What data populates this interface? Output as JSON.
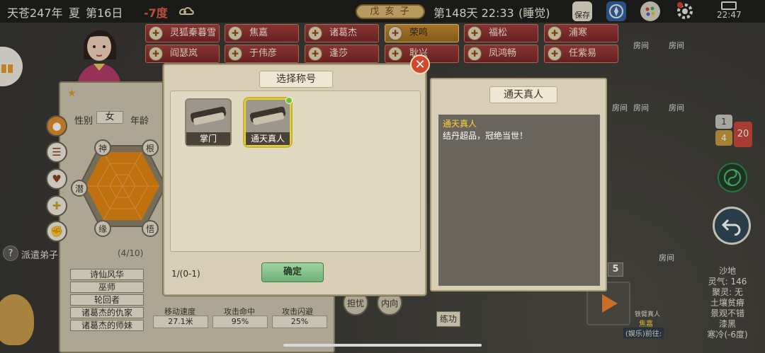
{
  "topbar": {
    "date": "天苍247年",
    "season": "夏",
    "day_label": "第16日",
    "temperature": "-7度",
    "ganzhi": "戊 亥 子",
    "day_count_time": "第148天 22:33",
    "status": "(睡觉)",
    "save_label": "保存",
    "clock": "22:47"
  },
  "disciples": [
    {
      "name": "灵狐秦暮雪",
      "selected": false
    },
    {
      "name": "焦嘉",
      "selected": false
    },
    {
      "name": "诸葛杰",
      "selected": false
    },
    {
      "name": "荣鸣",
      "selected": true
    },
    {
      "name": "福松",
      "selected": false
    },
    {
      "name": "浦寒",
      "selected": false
    },
    {
      "name": "阎瑟岚",
      "selected": false
    },
    {
      "name": "于伟彦",
      "selected": false
    },
    {
      "name": "逢莎",
      "selected": false
    },
    {
      "name": "耿兴",
      "selected": false
    },
    {
      "name": "凤鸿畅",
      "selected": false
    },
    {
      "name": "任紫易",
      "selected": false
    }
  ],
  "rooms": [
    "房间",
    "房间",
    "房间",
    "房间",
    "房间",
    "房间",
    "房间"
  ],
  "character": {
    "gender_label": "性别",
    "gender": "女",
    "age_label": "年龄",
    "attributes": [
      "神",
      "根",
      "潜",
      "缘",
      "悟"
    ],
    "dispatch_label": "派遣弟子",
    "dispatch_count": "(4/10)",
    "titles": [
      "诗仙风华",
      "巫师",
      "轮回者",
      "诸葛杰的仇家",
      "诸葛杰的师妹"
    ],
    "stats": [
      {
        "label": "移动速度",
        "value": "27.1米"
      },
      {
        "label": "攻击命中",
        "value": "95%"
      },
      {
        "label": "攻击闪避",
        "value": "25%"
      }
    ],
    "action_buttons": [
      "担忧",
      "内向",
      "练功"
    ]
  },
  "modal": {
    "title": "选择称号",
    "cards": [
      {
        "label": "掌门",
        "selected": false
      },
      {
        "label": "通天真人",
        "selected": true
      }
    ],
    "count": "1/(0-1)",
    "confirm_label": "确定"
  },
  "detail": {
    "header": "通天真人",
    "name": "通天真人",
    "description": "结丹超品，冠绝当世！"
  },
  "right": {
    "chat_counts": [
      "1",
      "4",
      "20"
    ],
    "level_badge": "5",
    "npc_name": "铁臂真人",
    "npc_sub": "焦嘉",
    "npc_action": "(娱乐)前往:",
    "info": [
      "沙地",
      "灵气: 146",
      "聚灵: 无",
      "土壤贫瘠",
      "景观不错",
      "漆黑",
      "寒冷(-6度)"
    ]
  },
  "colors": {
    "accent_red": "#a13a3a",
    "selected_gold": "#c98a2e",
    "title_yellow": "#ffd23a",
    "confirm_green": "#6fb278"
  }
}
